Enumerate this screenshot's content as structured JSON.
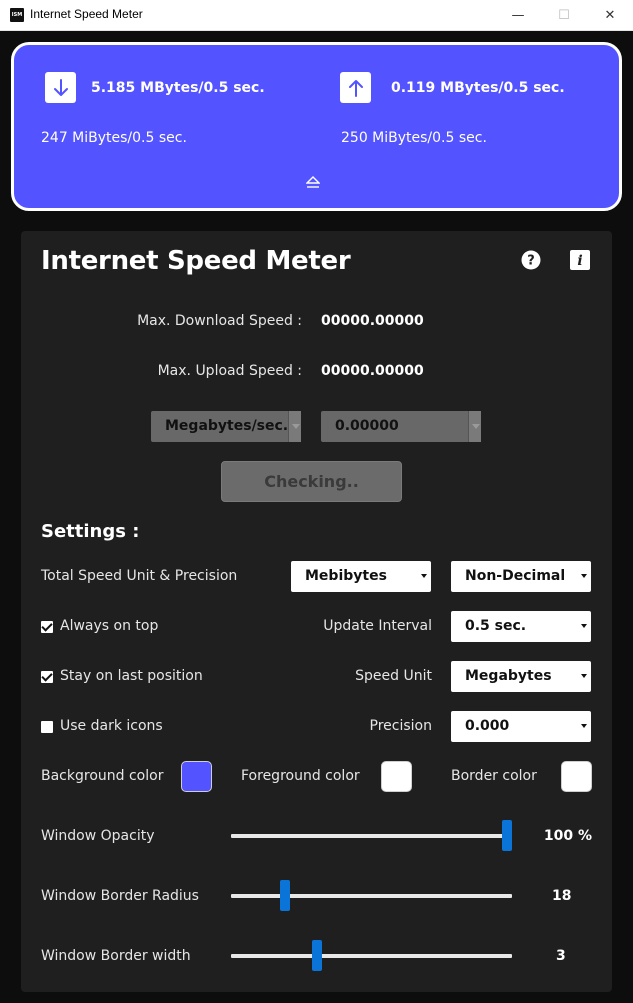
{
  "window": {
    "app_icon_text": "ISM",
    "title": "Internet Speed Meter",
    "minimize_glyph": "—",
    "maximize_glyph": "☐",
    "close_glyph": "✕"
  },
  "meter": {
    "download_speed": "5.185 MBytes/0.5 sec.",
    "upload_speed": "0.119 MBytes/0.5 sec.",
    "download_total": "247 MiBytes/0.5 sec.",
    "upload_total": "250 MiBytes/0.5 sec.",
    "download_icon": "arrow-down-icon",
    "upload_icon": "arrow-up-icon",
    "collapse_icon": "eject-icon"
  },
  "panel": {
    "title": "Internet Speed Meter",
    "help_icon": "question-circle-icon",
    "info_icon": "info-icon",
    "max_download_label": "Max. Download Speed :",
    "max_download_value": "00000.00000",
    "max_upload_label": "Max. Upload Speed :",
    "max_upload_value": "00000.00000",
    "unit_select_value": "Megabytes/sec.",
    "value_select_value": "0.00000",
    "check_button": "Checking.."
  },
  "settings": {
    "title": "Settings :",
    "total_unit_label": "Total Speed Unit & Precision",
    "total_unit_value": "Mebibytes",
    "total_precision_value": "Non-Decimal",
    "always_on_top": {
      "label": "Always on top",
      "checked": true
    },
    "stay_last_position": {
      "label": "Stay on last position",
      "checked": true
    },
    "use_dark_icons": {
      "label": "Use dark icons",
      "checked": false
    },
    "update_interval_label": "Update Interval",
    "update_interval_value": "0.5 sec.",
    "speed_unit_label": "Speed Unit",
    "speed_unit_value": "Megabytes",
    "precision_label": "Precision",
    "precision_value": "0.000",
    "background_color_label": "Background color",
    "background_color": "#5353ff",
    "foreground_color_label": "Foreground color",
    "foreground_color": "#ffffff",
    "border_color_label": "Border color",
    "border_color": "#ffffff",
    "opacity": {
      "label": "Window Opacity",
      "value_text": "100 %",
      "value": 100,
      "min": 0,
      "max": 100
    },
    "radius": {
      "label": "Window Border Radius",
      "value_text": "18",
      "value": 18,
      "min": 0,
      "max": 100
    },
    "border_width": {
      "label": "Window Border width",
      "value_text": "3",
      "value": 3,
      "min": 0,
      "max": 10
    }
  }
}
